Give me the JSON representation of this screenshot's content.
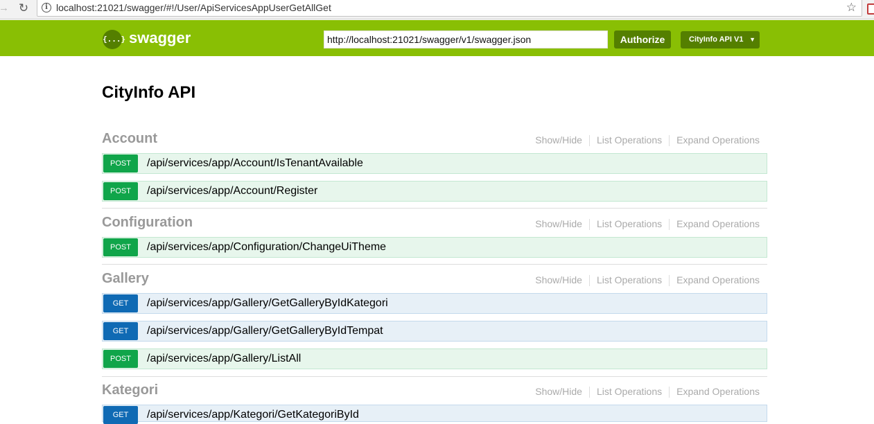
{
  "browser": {
    "url": "localhost:21021/swagger/#!/User/ApiServicesAppUserGetAllGet"
  },
  "header": {
    "logo_text": "swagger",
    "logo_glyph": "{...}",
    "spec_url": "http://localhost:21021/swagger/v1/swagger.json",
    "authorize_label": "Authorize",
    "api_version": "CityInfo API V1"
  },
  "colors": {
    "header_bg": "#89bf04",
    "header_button": "#547f00",
    "post": "#10a54a",
    "get": "#0f6ab4"
  },
  "main": {
    "title": "CityInfo API",
    "actions": {
      "show_hide": "Show/Hide",
      "list_operations": "List Operations",
      "expand_operations": "Expand Operations"
    },
    "resources": [
      {
        "name": "Account",
        "operations": [
          {
            "method": "POST",
            "path": "/api/services/app/Account/IsTenantAvailable"
          },
          {
            "method": "POST",
            "path": "/api/services/app/Account/Register"
          }
        ]
      },
      {
        "name": "Configuration",
        "operations": [
          {
            "method": "POST",
            "path": "/api/services/app/Configuration/ChangeUiTheme"
          }
        ]
      },
      {
        "name": "Gallery",
        "operations": [
          {
            "method": "GET",
            "path": "/api/services/app/Gallery/GetGalleryByIdKategori"
          },
          {
            "method": "GET",
            "path": "/api/services/app/Gallery/GetGalleryByIdTempat"
          },
          {
            "method": "POST",
            "path": "/api/services/app/Gallery/ListAll"
          }
        ]
      },
      {
        "name": "Kategori",
        "operations": [
          {
            "method": "GET",
            "path": "/api/services/app/Kategori/GetKategoriById"
          }
        ]
      }
    ]
  }
}
